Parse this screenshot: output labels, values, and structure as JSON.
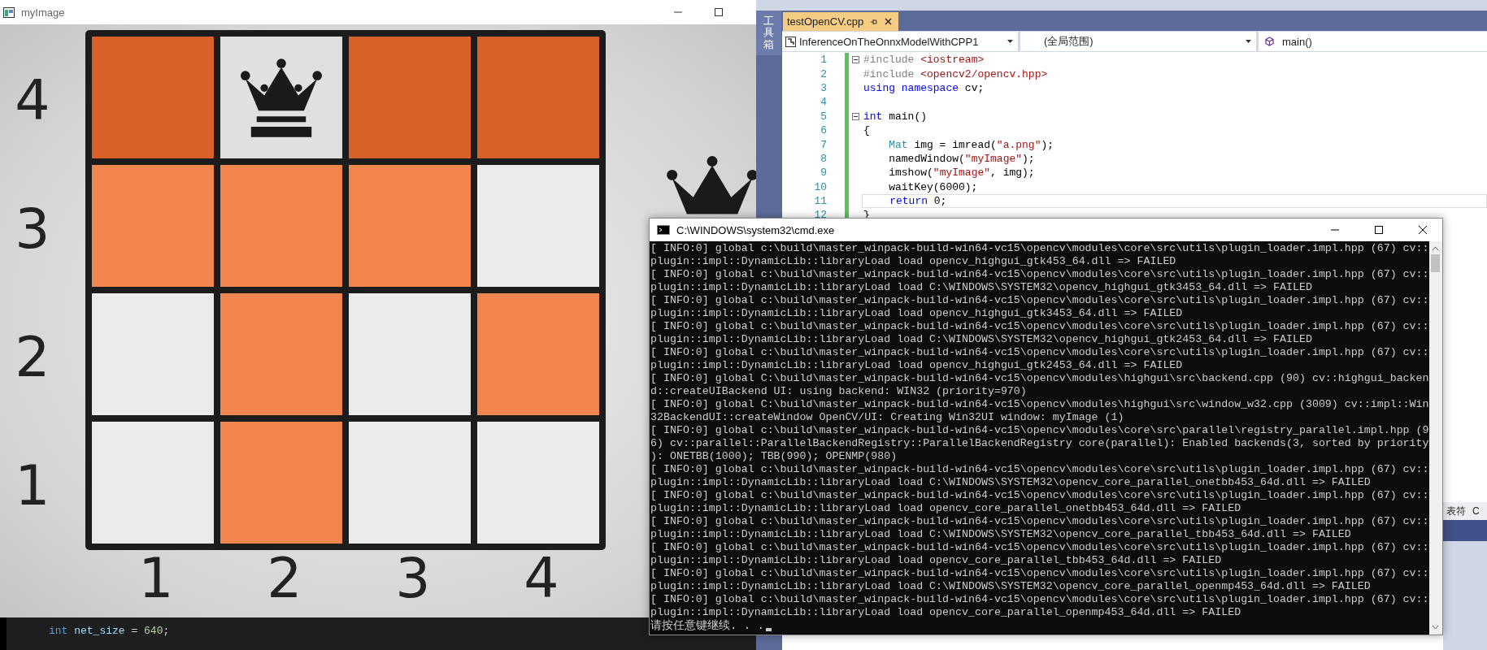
{
  "image_window": {
    "title": "myImage",
    "row_labels": [
      "4",
      "3",
      "2",
      "1"
    ],
    "column_labels": [
      "1",
      "2",
      "3",
      "4"
    ],
    "board": [
      [
        {
          "color": "#d9622b",
          "queen": false
        },
        {
          "color": "#e0e0e0",
          "queen": true
        },
        {
          "color": "#d9622b",
          "queen": false
        },
        {
          "color": "#d9622b",
          "queen": false
        }
      ],
      [
        {
          "color": "#f0854d",
          "queen": false
        },
        {
          "color": "#f0854d",
          "queen": false
        },
        {
          "color": "#f0854d",
          "queen": false
        },
        {
          "color": "#ebebeb",
          "queen": false
        }
      ],
      [
        {
          "color": "#ebebeb",
          "queen": false
        },
        {
          "color": "#f0854d",
          "queen": false
        },
        {
          "color": "#ebebeb",
          "queen": false
        },
        {
          "color": "#f0854d",
          "queen": false
        }
      ],
      [
        {
          "color": "#ebebeb",
          "queen": false
        },
        {
          "color": "#f0854d",
          "queen": false
        },
        {
          "color": "#ebebeb",
          "queen": false
        },
        {
          "color": "#ebebeb",
          "queen": false
        }
      ]
    ]
  },
  "editor": {
    "toolbox_label": "工具箱",
    "tabs": [
      {
        "label": "testOpenCV.cpp",
        "selected": true
      }
    ],
    "nav": [
      "InferenceOnTheOnnxModelWithCPP1",
      "(全局范围)",
      "main()"
    ],
    "lines": [
      {
        "number": "1",
        "fold": true,
        "current": false,
        "tokens": [
          {
            "kind": "preproc",
            "text": "#include "
          },
          {
            "kind": "string",
            "text": "<iostream>"
          }
        ]
      },
      {
        "number": "2",
        "fold": false,
        "current": false,
        "tokens": [
          {
            "kind": "preproc",
            "text": "#include "
          },
          {
            "kind": "string",
            "text": "<opencv2/opencv.hpp>"
          }
        ]
      },
      {
        "number": "3",
        "fold": false,
        "current": false,
        "tokens": [
          {
            "kind": "keyword",
            "text": "using namespace"
          },
          {
            "kind": "plain",
            "text": " cv;"
          }
        ]
      },
      {
        "number": "4",
        "fold": false,
        "current": false
      },
      {
        "number": "5",
        "fold": true,
        "current": false,
        "tokens": [
          {
            "kind": "keyword",
            "text": "int"
          },
          {
            "kind": "plain",
            "text": " main()"
          }
        ]
      },
      {
        "number": "6",
        "fold": false,
        "current": false,
        "tokens": [
          {
            "kind": "plain",
            "text": "{"
          }
        ]
      },
      {
        "number": "7",
        "fold": false,
        "current": false,
        "tokens": [
          {
            "kind": "type",
            "text": "    Mat"
          },
          {
            "kind": "plain",
            "text": " img = imread("
          },
          {
            "kind": "string",
            "text": "\"a.png\""
          },
          {
            "kind": "plain",
            "text": ");"
          }
        ]
      },
      {
        "number": "8",
        "fold": false,
        "current": false,
        "tokens": [
          {
            "kind": "plain",
            "text": "    namedWindow("
          },
          {
            "kind": "string",
            "text": "\"myImage\""
          },
          {
            "kind": "plain",
            "text": ");"
          }
        ]
      },
      {
        "number": "9",
        "fold": false,
        "current": false,
        "tokens": [
          {
            "kind": "plain",
            "text": "    imshow("
          },
          {
            "kind": "string",
            "text": "\"myImage\""
          },
          {
            "kind": "plain",
            "text": ", img);"
          }
        ]
      },
      {
        "number": "10",
        "fold": false,
        "current": false,
        "tokens": [
          {
            "kind": "plain",
            "text": "    waitKey(6000);"
          }
        ]
      },
      {
        "number": "11",
        "fold": false,
        "current": true,
        "tokens": [
          {
            "kind": "keyword",
            "text": "    return"
          },
          {
            "kind": "plain",
            "text": " 0;"
          }
        ]
      },
      {
        "number": "12",
        "fold": false,
        "current": false,
        "tokens": [
          {
            "kind": "plain",
            "text": "}"
          }
        ]
      }
    ]
  },
  "side_panel": {
    "tabs": [
      "表符",
      "C"
    ]
  },
  "background_editor": {
    "tokens": [
      {
        "kind": "keyword",
        "text": "int"
      },
      {
        "kind": "ident",
        "text": " net_size"
      },
      {
        "kind": "plain",
        "text": " = "
      },
      {
        "kind": "number",
        "text": "640"
      },
      {
        "kind": "plain",
        "text": ";"
      }
    ]
  },
  "console": {
    "title": "C:\\WINDOWS\\system32\\cmd.exe",
    "lines": [
      "[ INFO:0] global c:\\build\\master_winpack-build-win64-vc15\\opencv\\modules\\core\\src\\utils\\plugin_loader.impl.hpp (67) cv::",
      "plugin::impl::DynamicLib::libraryLoad load opencv_highgui_gtk453_64.dll => FAILED",
      "[ INFO:0] global c:\\build\\master_winpack-build-win64-vc15\\opencv\\modules\\core\\src\\utils\\plugin_loader.impl.hpp (67) cv::",
      "plugin::impl::DynamicLib::libraryLoad load C:\\WINDOWS\\SYSTEM32\\opencv_highgui_gtk3453_64.dll => FAILED",
      "[ INFO:0] global c:\\build\\master_winpack-build-win64-vc15\\opencv\\modules\\core\\src\\utils\\plugin_loader.impl.hpp (67) cv::",
      "plugin::impl::DynamicLib::libraryLoad load opencv_highgui_gtk3453_64.dll => FAILED",
      "[ INFO:0] global c:\\build\\master_winpack-build-win64-vc15\\opencv\\modules\\core\\src\\utils\\plugin_loader.impl.hpp (67) cv::",
      "plugin::impl::DynamicLib::libraryLoad load C:\\WINDOWS\\SYSTEM32\\opencv_highgui_gtk2453_64.dll => FAILED",
      "[ INFO:0] global c:\\build\\master_winpack-build-win64-vc15\\opencv\\modules\\core\\src\\utils\\plugin_loader.impl.hpp (67) cv::",
      "plugin::impl::DynamicLib::libraryLoad load opencv_highgui_gtk2453_64.dll => FAILED",
      "[ INFO:0] global C:\\build\\master_winpack-build-win64-vc15\\opencv\\modules\\highgui\\src\\backend.cpp (90) cv::highgui_backen",
      "d::createUIBackend UI: using backend: WIN32 (priority=970)",
      "[ INFO:0] global C:\\build\\master_winpack-build-win64-vc15\\opencv\\modules\\highgui\\src\\window_w32.cpp (3009) cv::impl::Win",
      "32BackendUI::createWindow OpenCV/UI: Creating Win32UI window: myImage (1)",
      "[ INFO:0] global c:\\build\\master_winpack-build-win64-vc15\\opencv\\modules\\core\\src\\parallel\\registry_parallel.impl.hpp (9",
      "6) cv::parallel::ParallelBackendRegistry::ParallelBackendRegistry core(parallel): Enabled backends(3, sorted by priority",
      "): ONETBB(1000); TBB(990); OPENMP(980)",
      "[ INFO:0] global c:\\build\\master_winpack-build-win64-vc15\\opencv\\modules\\core\\src\\utils\\plugin_loader.impl.hpp (67) cv::",
      "plugin::impl::DynamicLib::libraryLoad load C:\\WINDOWS\\SYSTEM32\\opencv_core_parallel_onetbb453_64d.dll => FAILED",
      "[ INFO:0] global c:\\build\\master_winpack-build-win64-vc15\\opencv\\modules\\core\\src\\utils\\plugin_loader.impl.hpp (67) cv::",
      "plugin::impl::DynamicLib::libraryLoad load opencv_core_parallel_onetbb453_64d.dll => FAILED",
      "[ INFO:0] global c:\\build\\master_winpack-build-win64-vc15\\opencv\\modules\\core\\src\\utils\\plugin_loader.impl.hpp (67) cv::",
      "plugin::impl::DynamicLib::libraryLoad load C:\\WINDOWS\\SYSTEM32\\opencv_core_parallel_tbb453_64d.dll => FAILED",
      "[ INFO:0] global c:\\build\\master_winpack-build-win64-vc15\\opencv\\modules\\core\\src\\utils\\plugin_loader.impl.hpp (67) cv::",
      "plugin::impl::DynamicLib::libraryLoad load opencv_core_parallel_tbb453_64d.dll => FAILED",
      "[ INFO:0] global c:\\build\\master_winpack-build-win64-vc15\\opencv\\modules\\core\\src\\utils\\plugin_loader.impl.hpp (67) cv::",
      "plugin::impl::DynamicLib::libraryLoad load C:\\WINDOWS\\SYSTEM32\\opencv_core_parallel_openmp453_64d.dll => FAILED",
      "[ INFO:0] global c:\\build\\master_winpack-build-win64-vc15\\opencv\\modules\\core\\src\\utils\\plugin_loader.impl.hpp (67) cv::",
      "plugin::impl::DynamicLib::libraryLoad load opencv_core_parallel_openmp453_64d.dll => FAILED"
    ],
    "prompt": "请按任意键继续. . ."
  }
}
